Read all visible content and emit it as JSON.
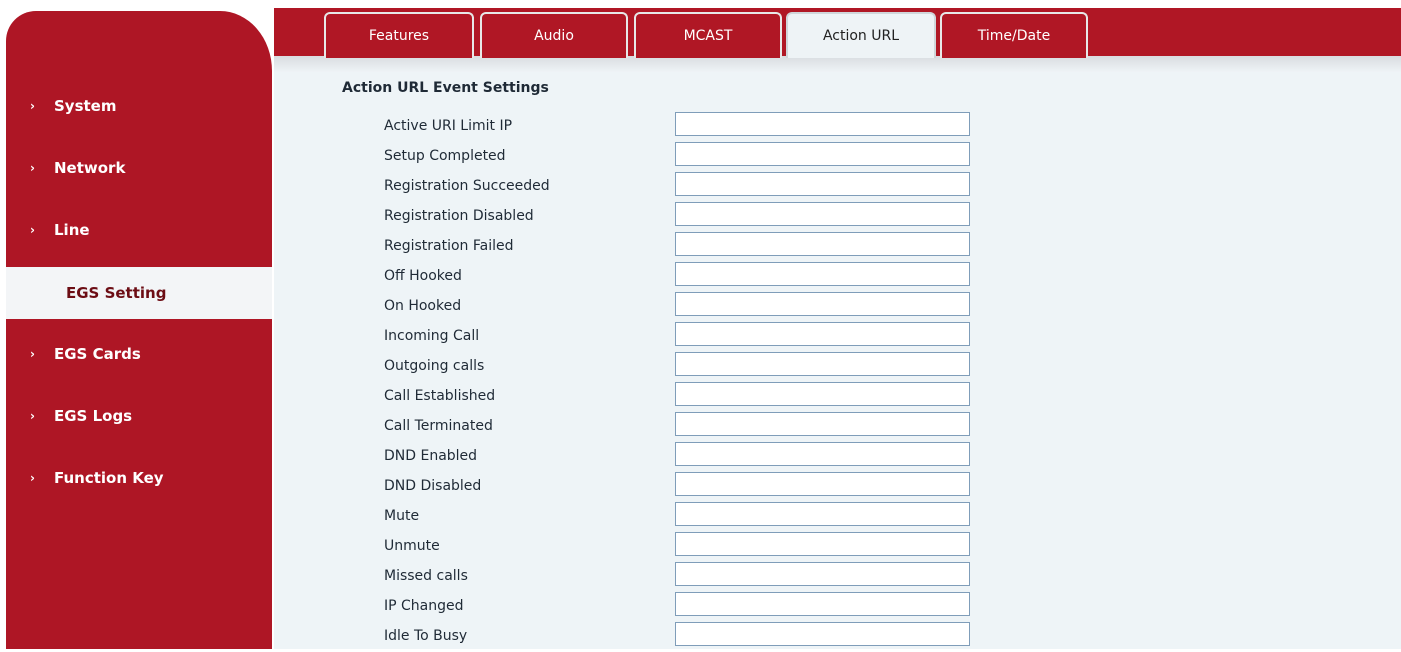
{
  "sidebar": {
    "items": [
      {
        "label": "System",
        "active": false
      },
      {
        "label": "Network",
        "active": false
      },
      {
        "label": "Line",
        "active": false
      },
      {
        "label": "EGS Setting",
        "active": true
      },
      {
        "label": "EGS Cards",
        "active": false
      },
      {
        "label": "EGS Logs",
        "active": false
      },
      {
        "label": "Function Key",
        "active": false
      }
    ]
  },
  "tabs": [
    {
      "label": "Features",
      "active": false
    },
    {
      "label": "Audio",
      "active": false
    },
    {
      "label": "MCAST",
      "active": false
    },
    {
      "label": "Action URL",
      "active": true
    },
    {
      "label": "Time/Date",
      "active": false
    }
  ],
  "section": {
    "title": "Action URL Event Settings",
    "fields": [
      {
        "label": "Active URI Limit IP",
        "value": ""
      },
      {
        "label": "Setup Completed",
        "value": ""
      },
      {
        "label": "Registration Succeeded",
        "value": ""
      },
      {
        "label": "Registration Disabled",
        "value": ""
      },
      {
        "label": "Registration Failed",
        "value": ""
      },
      {
        "label": "Off Hooked",
        "value": ""
      },
      {
        "label": "On Hooked",
        "value": ""
      },
      {
        "label": "Incoming Call",
        "value": ""
      },
      {
        "label": "Outgoing calls",
        "value": ""
      },
      {
        "label": "Call Established",
        "value": ""
      },
      {
        "label": "Call Terminated",
        "value": ""
      },
      {
        "label": "DND Enabled",
        "value": ""
      },
      {
        "label": "DND Disabled",
        "value": ""
      },
      {
        "label": "Mute",
        "value": ""
      },
      {
        "label": "Unmute",
        "value": ""
      },
      {
        "label": "Missed calls",
        "value": ""
      },
      {
        "label": "IP Changed",
        "value": ""
      },
      {
        "label": "Idle To Busy",
        "value": ""
      }
    ]
  },
  "colors": {
    "brand": "#b01725",
    "content_bg": "#eef4f7",
    "active_nav_bg": "#f3f5f7"
  }
}
